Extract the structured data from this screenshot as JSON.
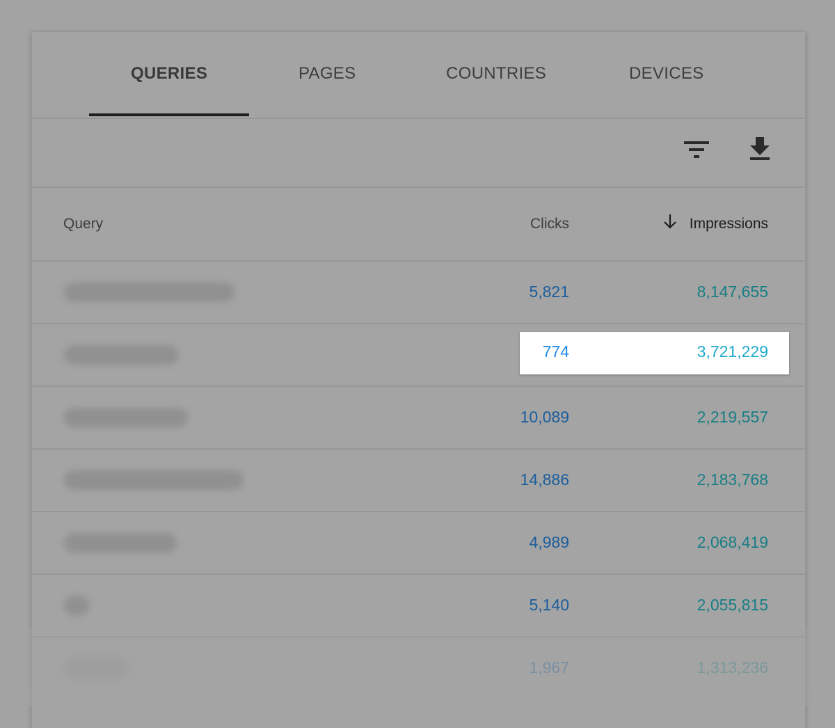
{
  "tabs": [
    {
      "label": "QUERIES",
      "active": true
    },
    {
      "label": "PAGES",
      "active": false
    },
    {
      "label": "COUNTRIES",
      "active": false
    },
    {
      "label": "DEVICES",
      "active": false
    }
  ],
  "toolbar": {
    "filter_icon": "filter-icon",
    "download_icon": "download-icon"
  },
  "table": {
    "columns": {
      "query": "Query",
      "clicks": "Clicks",
      "impressions": "Impressions",
      "sort_icon": "arrow-down-icon"
    },
    "rows": [
      {
        "query": "[blurred]",
        "clicks": "5,821",
        "impressions": "8,147,655"
      },
      {
        "query": "[blurred]",
        "clicks": "774",
        "impressions": "3,721,229",
        "highlighted": true
      },
      {
        "query": "[blurred]",
        "clicks": "10,089",
        "impressions": "2,219,557"
      },
      {
        "query": "[blurred]",
        "clicks": "14,886",
        "impressions": "2,183,768"
      },
      {
        "query": "[blurred]",
        "clicks": "4,989",
        "impressions": "2,068,419"
      },
      {
        "query": "[blurred]",
        "clicks": "5,140",
        "impressions": "2,055,815"
      },
      {
        "query": "[blurred]",
        "clicks": "1,967",
        "impressions": "1,313,236"
      }
    ]
  },
  "colors": {
    "clicks": "#1e88e5",
    "impressions": "#20aacb",
    "overlay": "#a3a3a3"
  }
}
